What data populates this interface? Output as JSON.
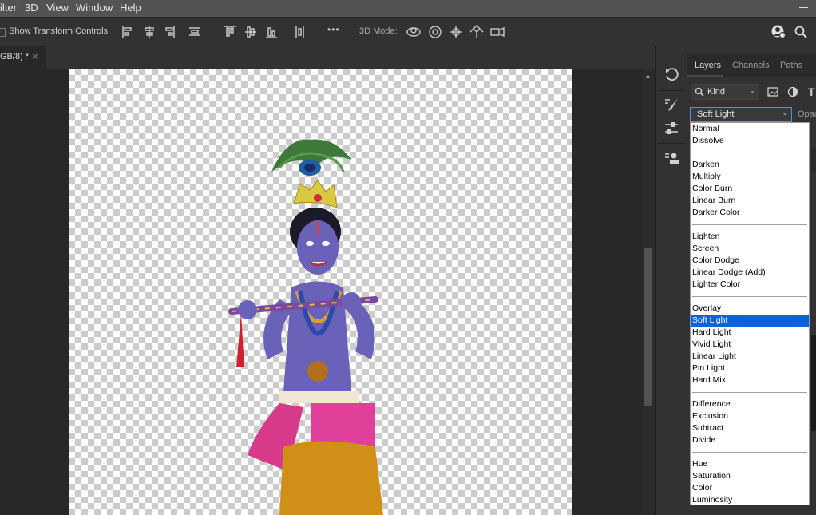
{
  "menubar": {
    "items": [
      "ilter",
      "3D",
      "View",
      "Window",
      "Help"
    ]
  },
  "options_bar": {
    "show_transform_controls": "Show Transform Controls",
    "show_transform_controls_checked": false,
    "more": "•••",
    "mode_label": "3D Mode:"
  },
  "document_tab": {
    "title": "GB/8) *",
    "close": "×"
  },
  "panel": {
    "collapse": "‹‹",
    "tabs": [
      "Layers",
      "Channels",
      "Paths"
    ],
    "filter_kind": "Kind",
    "blend_mode": "Soft Light",
    "opacity_label": "Opac",
    "type_icon_label": "T"
  },
  "blend_modes": {
    "groups": [
      [
        "Normal",
        "Dissolve"
      ],
      [
        "Darken",
        "Multiply",
        "Color Burn",
        "Linear Burn",
        "Darker Color"
      ],
      [
        "Lighten",
        "Screen",
        "Color Dodge",
        "Linear Dodge (Add)",
        "Lighter Color"
      ],
      [
        "Overlay",
        "Soft Light",
        "Hard Light",
        "Vivid Light",
        "Linear Light",
        "Pin Light",
        "Hard Mix"
      ],
      [
        "Difference",
        "Exclusion",
        "Subtract",
        "Divide"
      ],
      [
        "Hue",
        "Saturation",
        "Color",
        "Luminosity"
      ]
    ],
    "selected": "Soft Light"
  },
  "colors": {
    "accent": "#0a64d6",
    "focus_border": "#4b92e1"
  }
}
